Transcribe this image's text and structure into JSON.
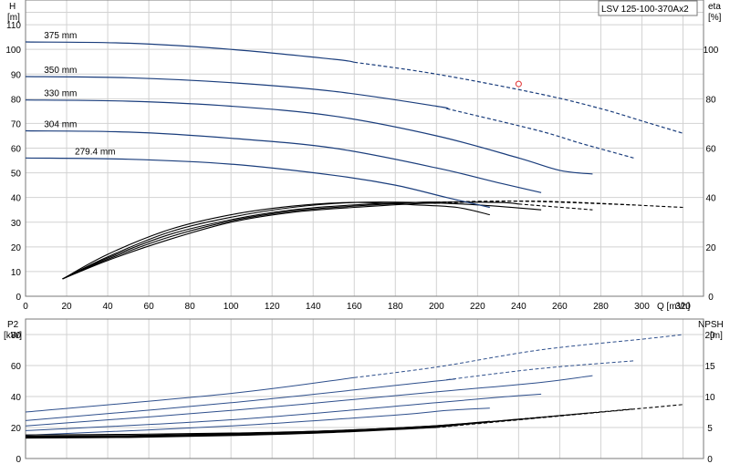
{
  "chart_title": "LSV 125-100-370Ax2",
  "colors": {
    "head": "#1a3d7c",
    "eta": "#000000",
    "p2": "#2e4f8c",
    "npsh": "#000000",
    "duty_point": "#e03030"
  },
  "chart_data": [
    {
      "type": "line",
      "title": "LSV 125-100-370Ax2",
      "xlabel": "Q [m³/h]",
      "ylabel": "H [m]",
      "y2label": "eta [%]",
      "left_axis_name": "H",
      "left_axis_unit": "[m]",
      "right_axis_name": "eta",
      "right_axis_unit": "[%]",
      "xlim": [
        0,
        330
      ],
      "ylim": [
        0,
        120
      ],
      "y2lim": [
        0,
        120
      ],
      "xticks": [
        "0",
        "20",
        "40",
        "60",
        "80",
        "100",
        "120",
        "140",
        "160",
        "180",
        "200",
        "220",
        "240",
        "260",
        "280",
        "300",
        "320"
      ],
      "yticks": [
        "0",
        "10",
        "20",
        "30",
        "40",
        "50",
        "60",
        "70",
        "80",
        "90",
        "100",
        "110"
      ],
      "y2ticks": [
        "0",
        "20",
        "40",
        "60",
        "80",
        "100"
      ],
      "grid": true,
      "duty_point": {
        "x": 240,
        "y": 86
      },
      "head_series": [
        {
          "name": "375 mm",
          "x": [
            0,
            50,
            100,
            150,
            200,
            250,
            280,
            300,
            320
          ],
          "y": [
            103,
            102.5,
            100,
            96,
            90,
            82,
            76,
            71,
            66
          ],
          "solid_until": 160
        },
        {
          "name": "350 mm",
          "x": [
            0,
            50,
            100,
            150,
            200,
            250,
            270,
            296
          ],
          "y": [
            89,
            88.5,
            86.5,
            83,
            77,
            67,
            62,
            56
          ],
          "solid_until": 205
        },
        {
          "name": "330 mm",
          "x": [
            0,
            50,
            100,
            150,
            200,
            240,
            260,
            276
          ],
          "y": [
            79.5,
            79,
            77,
            73,
            65,
            56,
            51,
            49.5
          ],
          "solid_until": 276
        },
        {
          "name": "304 mm",
          "x": [
            0,
            50,
            100,
            150,
            200,
            230,
            251
          ],
          "y": [
            67,
            66.5,
            64,
            60,
            52,
            46,
            42
          ],
          "solid_until": 251
        },
        {
          "name": "279.4 mm",
          "x": [
            0,
            50,
            100,
            150,
            180,
            205,
            226
          ],
          "y": [
            56,
            55.5,
            53.5,
            49,
            45,
            40,
            36
          ],
          "solid_until": 226
        }
      ],
      "eta_series": [
        {
          "x": [
            18,
            40,
            70,
            100,
            130,
            160,
            190,
            210,
            226
          ],
          "y": [
            7,
            17,
            27,
            33,
            36.5,
            38,
            37,
            36,
            33
          ],
          "solid_until": 226
        },
        {
          "x": [
            18,
            40,
            70,
            100,
            130,
            160,
            190,
            220,
            251
          ],
          "y": [
            7,
            16,
            26,
            32,
            36,
            38,
            38,
            37,
            35
          ],
          "solid_until": 251
        },
        {
          "x": [
            18,
            40,
            70,
            100,
            130,
            160,
            190,
            230,
            276
          ],
          "y": [
            7,
            15.5,
            25,
            31,
            35,
            37,
            38,
            38,
            35
          ],
          "solid_until": 240
        },
        {
          "x": [
            18,
            40,
            70,
            100,
            130,
            160,
            190,
            240,
            296
          ],
          "y": [
            7,
            15,
            24,
            30.5,
            34.5,
            36.5,
            38,
            38.5,
            37
          ],
          "solid_until": 200
        },
        {
          "x": [
            18,
            40,
            70,
            100,
            130,
            160,
            190,
            250,
            320
          ],
          "y": [
            7,
            14.5,
            23,
            30,
            34,
            36,
            37.5,
            38.5,
            36
          ],
          "solid_until": 200
        }
      ]
    },
    {
      "type": "line",
      "xlabel": "",
      "ylabel": "P2 [kW]",
      "y2label": "NPSH [m]",
      "left_axis_name": "P2",
      "left_axis_unit": "[kW]",
      "right_axis_name": "NPSH",
      "right_axis_unit": "[m]",
      "xlim": [
        0,
        330
      ],
      "ylim": [
        0,
        90
      ],
      "y2lim": [
        0,
        22.5
      ],
      "yticks": [
        "0",
        "20",
        "40",
        "60",
        "80"
      ],
      "y2ticks": [
        "0",
        "5",
        "10",
        "15",
        "20"
      ],
      "grid": true,
      "p2_series": [
        {
          "x": [
            0,
            100,
            200,
            250,
            300,
            320
          ],
          "y": [
            30,
            42,
            59,
            70,
            77,
            80
          ],
          "solid_until": 160
        },
        {
          "x": [
            0,
            100,
            200,
            250,
            296
          ],
          "y": [
            24.5,
            36,
            50,
            58,
            63
          ],
          "solid_until": 205
        },
        {
          "x": [
            0,
            100,
            200,
            250,
            276
          ],
          "y": [
            21,
            31,
            43,
            49,
            53.5
          ],
          "solid_until": 276
        },
        {
          "x": [
            0,
            100,
            200,
            230,
            251
          ],
          "y": [
            18,
            25,
            36,
            39.5,
            41.5
          ],
          "solid_until": 251
        },
        {
          "x": [
            0,
            100,
            180,
            205,
            226
          ],
          "y": [
            15,
            21,
            28,
            31,
            32.5
          ],
          "solid_until": 226
        }
      ],
      "npsh_series": [
        {
          "x": [
            0,
            50,
            100,
            150,
            200,
            226
          ],
          "y": [
            3.8,
            3.9,
            4.1,
            4.5,
            5.3,
            6.0
          ],
          "solid_until": 226
        },
        {
          "x": [
            0,
            50,
            100,
            150,
            200,
            251
          ],
          "y": [
            3.6,
            3.7,
            4.0,
            4.5,
            5.3,
            6.6
          ],
          "solid_until": 251
        },
        {
          "x": [
            0,
            50,
            100,
            150,
            200,
            276
          ],
          "y": [
            3.5,
            3.6,
            3.9,
            4.4,
            5.2,
            7.4
          ],
          "solid_until": 240
        },
        {
          "x": [
            0,
            50,
            100,
            150,
            200,
            296
          ],
          "y": [
            3.4,
            3.5,
            3.8,
            4.3,
            5.1,
            8.0
          ],
          "solid_until": 210
        },
        {
          "x": [
            0,
            50,
            100,
            150,
            200,
            320
          ],
          "y": [
            3.3,
            3.4,
            3.7,
            4.2,
            5.0,
            8.7
          ],
          "solid_until": 200
        }
      ]
    }
  ]
}
